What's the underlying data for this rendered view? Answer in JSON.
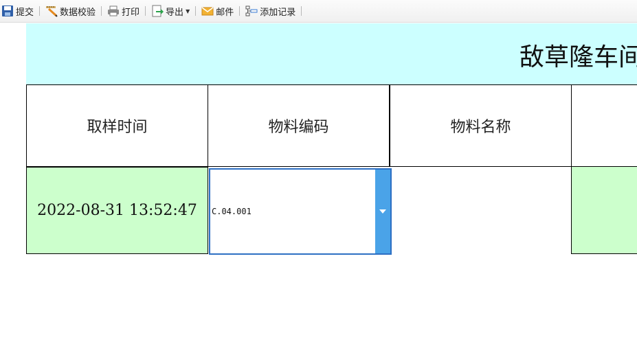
{
  "toolbar": {
    "submit": "提交",
    "validate": "数据校验",
    "print": "打印",
    "export": "导出",
    "mail": "邮件",
    "add_record": "添加记录"
  },
  "report": {
    "title": "敌草隆车间"
  },
  "table": {
    "headers": [
      "取样时间",
      "物料编码",
      "物料名称"
    ],
    "row": {
      "sample_time": "2022-08-31 13:52:47",
      "material_code": "C.04.001",
      "material_name": ""
    }
  },
  "colors": {
    "title_band": "#ccffff",
    "row_highlight": "#ccffcc",
    "combo_border": "#2d6fc3",
    "combo_button": "#4aa3e8"
  }
}
